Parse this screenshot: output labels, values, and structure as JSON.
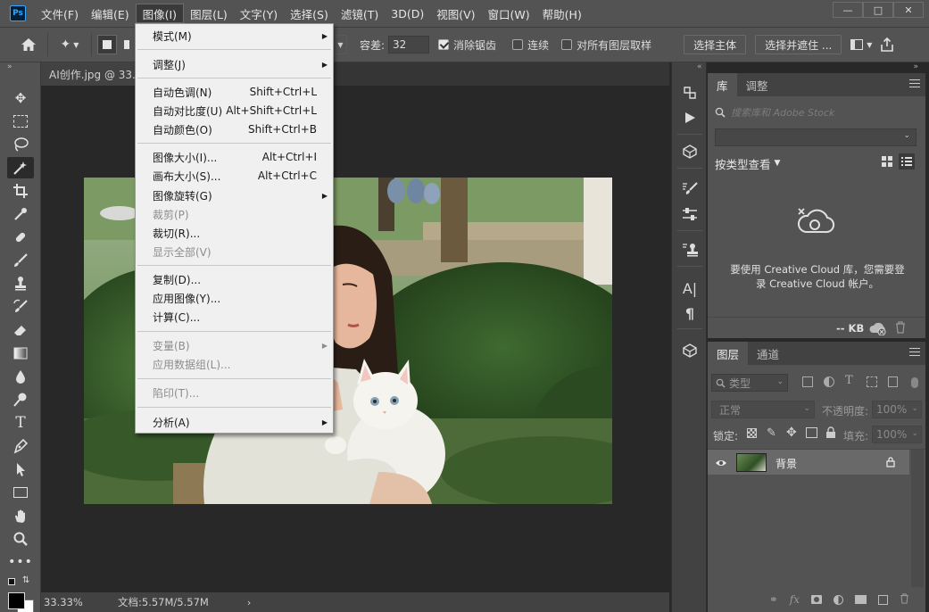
{
  "app": {
    "logo": "Ps",
    "menus": [
      "文件(F)",
      "编辑(E)",
      "图像(I)",
      "图层(L)",
      "文字(Y)",
      "选择(S)",
      "滤镜(T)",
      "3D(D)",
      "视图(V)",
      "窗口(W)",
      "帮助(H)"
    ],
    "active_menu": "图像(I)",
    "window_controls": [
      "minimize-icon",
      "maximize-icon",
      "close-icon"
    ]
  },
  "options": {
    "tolerance_label": "容差:",
    "tolerance_value": "32",
    "antialias_label": "消除锯齿",
    "antialias_checked": true,
    "contiguous_label": "连续",
    "contiguous_checked": false,
    "all_layers_label": "对所有图层取样",
    "all_layers_checked": false,
    "select_subject": "选择主体",
    "select_mask": "选择并遮住 ..."
  },
  "document": {
    "tab_title": "AI创作.jpg @ 33.3",
    "zoom": "33.33%",
    "doc_info": "文档:5.57M/5.57M"
  },
  "image_menu": {
    "items": [
      {
        "label": "模式(M)",
        "shortcut": "",
        "submenu": true,
        "disabled": false
      },
      {
        "label": "调整(J)",
        "shortcut": "",
        "submenu": true,
        "disabled": false
      },
      {
        "label": "自动色调(N)",
        "shortcut": "Shift+Ctrl+L",
        "submenu": false,
        "disabled": false
      },
      {
        "label": "自动对比度(U)",
        "shortcut": "Alt+Shift+Ctrl+L",
        "submenu": false,
        "disabled": false
      },
      {
        "label": "自动颜色(O)",
        "shortcut": "Shift+Ctrl+B",
        "submenu": false,
        "disabled": false
      },
      {
        "label": "图像大小(I)...",
        "shortcut": "Alt+Ctrl+I",
        "submenu": false,
        "disabled": false
      },
      {
        "label": "画布大小(S)...",
        "shortcut": "Alt+Ctrl+C",
        "submenu": false,
        "disabled": false
      },
      {
        "label": "图像旋转(G)",
        "shortcut": "",
        "submenu": true,
        "disabled": false
      },
      {
        "label": "裁剪(P)",
        "shortcut": "",
        "submenu": false,
        "disabled": true
      },
      {
        "label": "裁切(R)...",
        "shortcut": "",
        "submenu": false,
        "disabled": false
      },
      {
        "label": "显示全部(V)",
        "shortcut": "",
        "submenu": false,
        "disabled": true
      },
      {
        "label": "复制(D)...",
        "shortcut": "",
        "submenu": false,
        "disabled": false
      },
      {
        "label": "应用图像(Y)...",
        "shortcut": "",
        "submenu": false,
        "disabled": false
      },
      {
        "label": "计算(C)...",
        "shortcut": "",
        "submenu": false,
        "disabled": false
      },
      {
        "label": "变量(B)",
        "shortcut": "",
        "submenu": true,
        "disabled": true
      },
      {
        "label": "应用数据组(L)...",
        "shortcut": "",
        "submenu": false,
        "disabled": true
      },
      {
        "label": "陷印(T)...",
        "shortcut": "",
        "submenu": false,
        "disabled": true
      },
      {
        "label": "分析(A)",
        "shortcut": "",
        "submenu": true,
        "disabled": false
      }
    ]
  },
  "library_panel": {
    "tabs": [
      "库",
      "调整"
    ],
    "search_placeholder": "搜索库和 Adobe Stock",
    "view_by": "按类型查看",
    "cc_message": "要使用 Creative Cloud 库，您需要登录 Creative Cloud 帐户。",
    "size": "-- KB"
  },
  "layers_panel": {
    "tabs": [
      "图层",
      "通道"
    ],
    "filter_kind": "类型",
    "blend_mode": "正常",
    "opacity_label": "不透明度:",
    "opacity_value": "100%",
    "lock_label": "锁定:",
    "fill_label": "填充:",
    "fill_value": "100%",
    "layers": [
      {
        "name": "背景",
        "visible": true,
        "locked": true
      }
    ]
  },
  "colors": {
    "menubar_bg": "#535353",
    "panel_bg": "#535353",
    "canvas_bg": "#282828",
    "menu_bg": "#f0f0f0",
    "ps_blue": "#31a8ff"
  }
}
